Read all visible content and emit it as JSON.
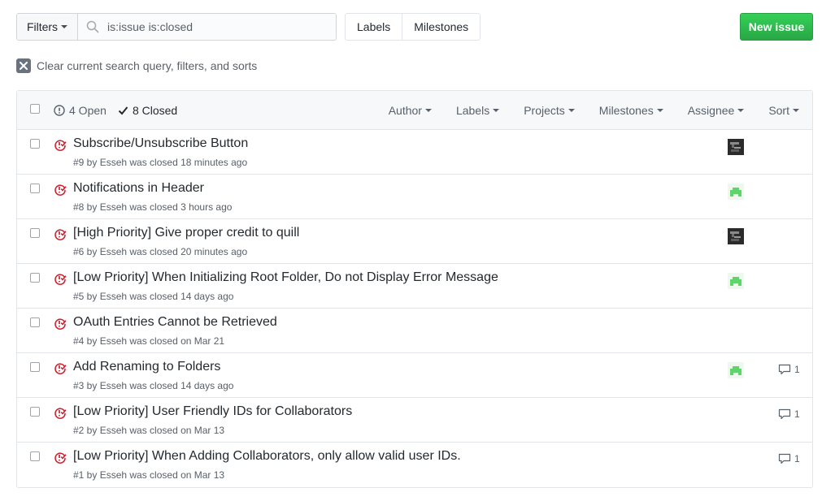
{
  "toolbar": {
    "filters_label": "Filters",
    "search_value": "is:issue is:closed",
    "labels_label": "Labels",
    "milestones_label": "Milestones",
    "new_issue_label": "New issue"
  },
  "clear_query_label": "Clear current search query, filters, and sorts",
  "issues_header": {
    "open_label": "4 Open",
    "closed_label": "8 Closed",
    "filters": [
      "Author",
      "Labels",
      "Projects",
      "Milestones",
      "Assignee",
      "Sort"
    ]
  },
  "colors": {
    "closed_icon": "#cb2431",
    "new_issue_green": "#28a745",
    "avatar_green": "#5fd46a"
  },
  "issues": [
    {
      "title": "Subscribe/Unsubscribe Button",
      "meta": "#9 by Esseh was closed 18 minutes ago",
      "avatar": "dark",
      "comments": null
    },
    {
      "title": "Notifications in Header",
      "meta": "#8 by Esseh was closed 3 hours ago",
      "avatar": "green",
      "comments": null
    },
    {
      "title": "[High Priority] Give proper credit to quill",
      "meta": "#6 by Esseh was closed 20 minutes ago",
      "avatar": "dark",
      "comments": null
    },
    {
      "title": "[Low Priority] When Initializing Root Folder, Do not Display Error Message",
      "meta": "#5 by Esseh was closed 14 days ago",
      "avatar": "green",
      "comments": null
    },
    {
      "title": "OAuth Entries Cannot be Retrieved",
      "meta": "#4 by Esseh was closed on Mar 21",
      "avatar": null,
      "comments": null
    },
    {
      "title": "Add Renaming to Folders",
      "meta": "#3 by Esseh was closed 14 days ago",
      "avatar": "green",
      "comments": "1"
    },
    {
      "title": "[Low Priority] User Friendly IDs for Collaborators",
      "meta": "#2 by Esseh was closed on Mar 13",
      "avatar": null,
      "comments": "1"
    },
    {
      "title": "[Low Priority] When Adding Collaborators, only allow valid user IDs.",
      "meta": "#1 by Esseh was closed on Mar 13",
      "avatar": null,
      "comments": "1"
    }
  ]
}
